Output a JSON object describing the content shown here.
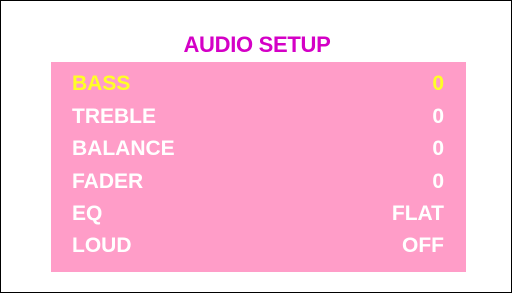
{
  "title": "AUDIO SETUP",
  "colors": {
    "title": "#d400c6",
    "panel": "#ff9dc8",
    "text": "#ffffff",
    "selected": "#ffff26",
    "border": "#000000"
  },
  "items": [
    {
      "label": "BASS",
      "value": "0",
      "selected": true
    },
    {
      "label": "TREBLE",
      "value": "0",
      "selected": false
    },
    {
      "label": "BALANCE",
      "value": "0",
      "selected": false
    },
    {
      "label": "FADER",
      "value": "0",
      "selected": false
    },
    {
      "label": "EQ",
      "value": "FLAT",
      "selected": false
    },
    {
      "label": "LOUD",
      "value": "OFF",
      "selected": false
    }
  ]
}
